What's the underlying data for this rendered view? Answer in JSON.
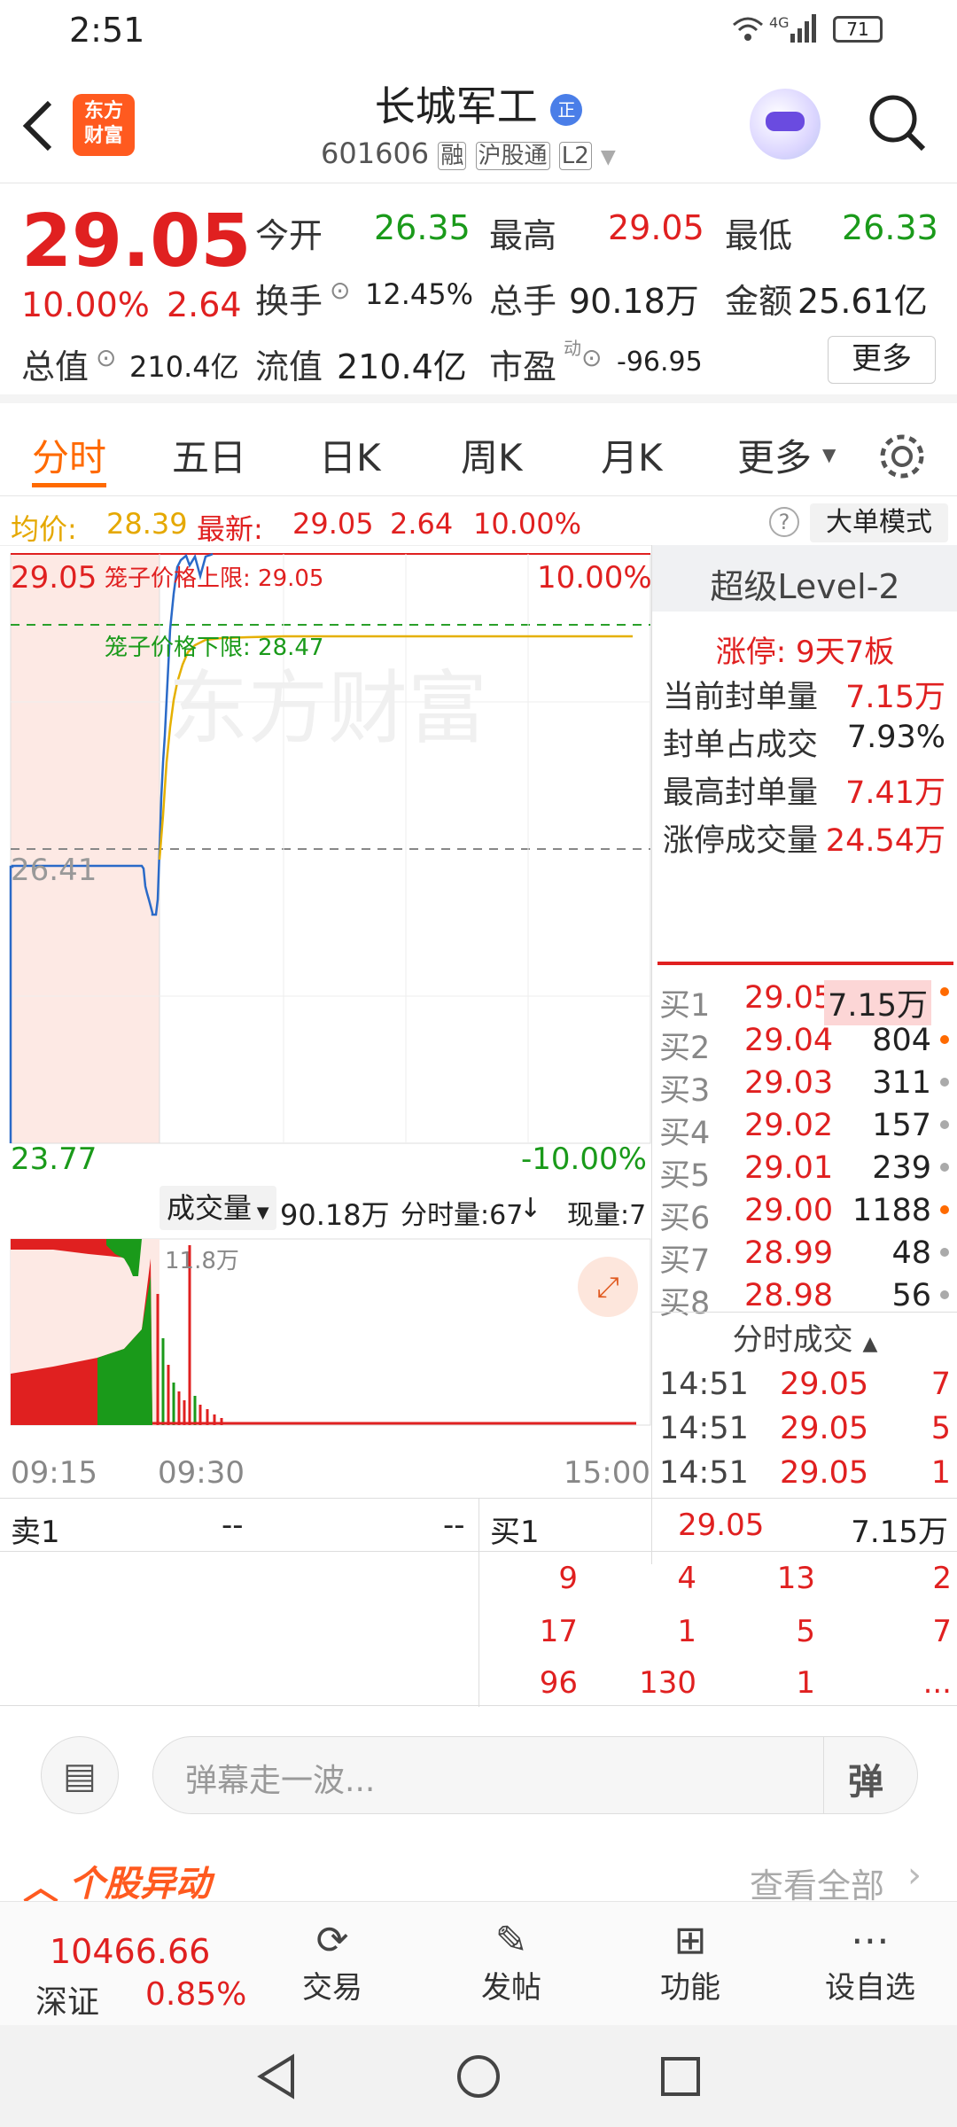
{
  "status": {
    "time": "2:51",
    "network": "4G",
    "battery": "71"
  },
  "header": {
    "title": "长城军工",
    "badge": "正",
    "code": "601606",
    "tags": [
      "融",
      "沪股通",
      "L2"
    ],
    "logo_line1": "东方",
    "logo_line2": "财富"
  },
  "quote": {
    "price": "29.05",
    "pct": "10.00%",
    "chg": "2.64",
    "open_label": "今开",
    "open": "26.35",
    "high_label": "最高",
    "high": "29.05",
    "low_label": "最低",
    "low": "26.33",
    "turnover_label": "换手",
    "turnover": "12.45%",
    "vol_label": "总手",
    "vol": "90.18万",
    "amount_label": "金额",
    "amount": "25.61亿",
    "mcap_label": "总值",
    "mcap": "210.4亿",
    "float_label": "流值",
    "float": "210.4亿",
    "pe_label": "市盈",
    "pe_sup": "动",
    "pe": "-96.95",
    "more": "更多"
  },
  "tabs": [
    "分时",
    "五日",
    "日K",
    "周K",
    "月K",
    "更多"
  ],
  "legend": {
    "avg_label": "均价:",
    "avg": "28.39",
    "latest_label": "最新:",
    "latest": "29.05",
    "chg": "2.64",
    "pct": "10.00%",
    "mode_btn": "大单模式"
  },
  "chart": {
    "top_price": "29.05",
    "top_pct": "10.00%",
    "mid_price": "26.41",
    "bottom_price": "23.77",
    "bottom_pct": "-10.00%",
    "cage_upper": "笼子价格上限:  29.05",
    "cage_lower": "笼子价格下限:  28.47",
    "watermark": "东方财富"
  },
  "volbar": {
    "label": "成交量",
    "total": "90.18万",
    "minute_label": "分时量:67",
    "current_label": "现量:7",
    "max_label": "11.8万"
  },
  "time_axis": [
    "09:15",
    "09:30",
    "15:00"
  ],
  "panel": {
    "title": "超级Level-2",
    "limit": "涨停:  9天7板",
    "stats": [
      {
        "k": "当前封单量",
        "v": "7.15万"
      },
      {
        "k": "封单占成交",
        "v": "7.93%"
      },
      {
        "k": "最高封单量",
        "v": "7.41万"
      },
      {
        "k": "涨停成交量",
        "v": "24.54万"
      }
    ],
    "bids": [
      {
        "k": "买1",
        "p": "29.05",
        "v": "7.15万"
      },
      {
        "k": "买2",
        "p": "29.04",
        "v": "804"
      },
      {
        "k": "买3",
        "p": "29.03",
        "v": "311"
      },
      {
        "k": "买4",
        "p": "29.02",
        "v": "157"
      },
      {
        "k": "买5",
        "p": "29.01",
        "v": "239"
      },
      {
        "k": "买6",
        "p": "29.00",
        "v": "1188"
      },
      {
        "k": "买7",
        "p": "28.99",
        "v": "48"
      },
      {
        "k": "买8",
        "p": "28.98",
        "v": "56"
      }
    ],
    "trades_title": "分时成交",
    "trades": [
      {
        "t": "14:51",
        "p": "29.05",
        "v": "7"
      },
      {
        "t": "14:51",
        "p": "29.05",
        "v": "5"
      },
      {
        "t": "14:51",
        "p": "29.05",
        "v": "1"
      }
    ]
  },
  "orderbook": {
    "sell_label": "卖1",
    "sell_p": "--",
    "sell_v": "--",
    "buy_label": "买1",
    "buy_p": "29.05",
    "buy_v": "7.15万",
    "queue": [
      [
        "9",
        "4",
        "13",
        "2"
      ],
      [
        "17",
        "1",
        "5",
        "7"
      ],
      [
        "96",
        "130",
        "1",
        "..."
      ]
    ]
  },
  "danmu": {
    "placeholder": "弹幕走一波...",
    "send": "弹",
    "section": "个股异动",
    "view_all": "查看全部"
  },
  "bottom": {
    "index_val": "10466.66",
    "index_name": "深证",
    "index_pct": "0.85%",
    "items": [
      "交易",
      "发帖",
      "功能",
      "设自选"
    ]
  }
}
